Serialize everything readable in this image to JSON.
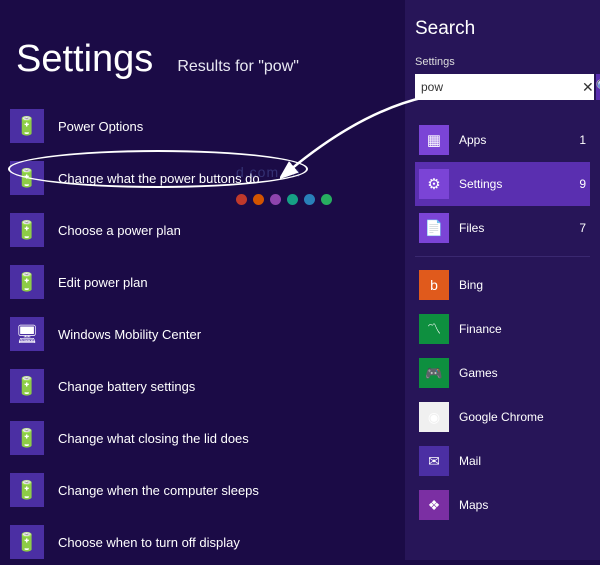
{
  "left": {
    "heading": "Settings",
    "subheading": "Results for \"pow\"",
    "results": [
      {
        "label": "Power Options",
        "icon": "battery"
      },
      {
        "label": "Change what the power buttons do",
        "icon": "battery"
      },
      {
        "label": "Choose a power plan",
        "icon": "battery"
      },
      {
        "label": "Edit power plan",
        "icon": "battery"
      },
      {
        "label": "Windows Mobility Center",
        "icon": "mobility"
      },
      {
        "label": "Change battery settings",
        "icon": "battery"
      },
      {
        "label": "Change what closing the lid does",
        "icon": "battery"
      },
      {
        "label": "Change when the computer sleeps",
        "icon": "battery"
      },
      {
        "label": "Choose when to turn off display",
        "icon": "battery"
      }
    ]
  },
  "right": {
    "title": "Search",
    "context": "Settings",
    "search_value": "pow",
    "categories": [
      {
        "name": "Apps",
        "count": "1",
        "icon": "apps",
        "selected": false
      },
      {
        "name": "Settings",
        "count": "9",
        "icon": "settings",
        "selected": true
      },
      {
        "name": "Files",
        "count": "7",
        "icon": "files",
        "selected": false
      }
    ],
    "apps": [
      {
        "name": "Bing",
        "color": "#e05a1c",
        "glyph": "b"
      },
      {
        "name": "Finance",
        "color": "#0e8f3f",
        "glyph": "〽"
      },
      {
        "name": "Games",
        "color": "#0e8f3f",
        "glyph": "🎮"
      },
      {
        "name": "Google Chrome",
        "color": "#f0f0f0",
        "glyph": "◉"
      },
      {
        "name": "Mail",
        "color": "#4b2fa3",
        "glyph": "✉"
      },
      {
        "name": "Maps",
        "color": "#7b2fa3",
        "glyph": "❖"
      }
    ]
  },
  "watermark": "d.com.vn",
  "dot_colors": [
    "#c0392b",
    "#d35400",
    "#8e44ad",
    "#16a085",
    "#2980b9",
    "#27ae60"
  ]
}
